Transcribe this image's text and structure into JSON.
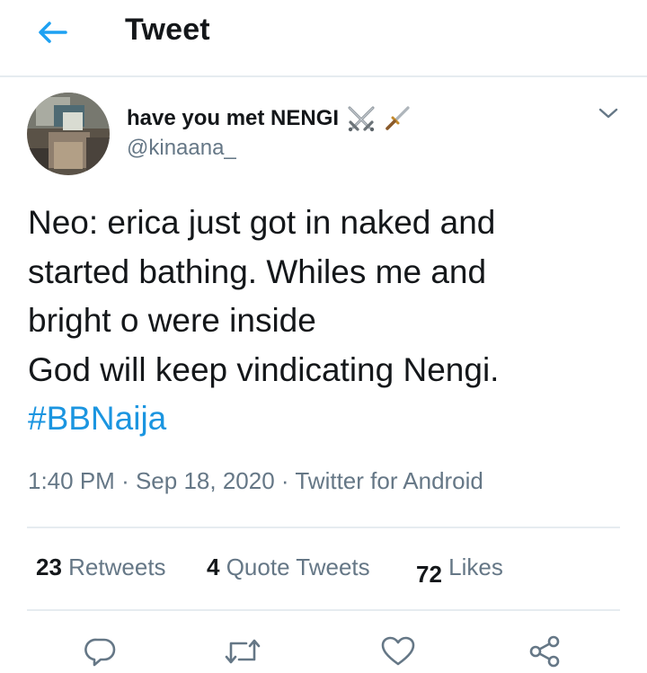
{
  "header": {
    "title": "Tweet",
    "back_icon": "arrow-left-icon",
    "accent": "#1da1f2"
  },
  "author": {
    "display_name": "have you met NENGI",
    "emoji": [
      "crossed-swords-icon",
      "dagger-icon"
    ],
    "handle": "@kinaana_"
  },
  "tweet": {
    "lines": [
      "Neo: erica just got in naked and",
      "started bathing. Whiles me and",
      "bright o were inside",
      "God will keep vindicating Nengi."
    ],
    "hashtag": "#BBNaija",
    "hashtag_color": "#1b95e0",
    "time": "1:40 PM",
    "date": "Sep 18, 2020",
    "source": "Twitter for Android",
    "separator": "·"
  },
  "stats": {
    "retweets": {
      "count": "23",
      "label": "Retweets"
    },
    "quotes": {
      "count": "4",
      "label": "Quote Tweets"
    },
    "likes": {
      "count": "72",
      "label": "Likes"
    }
  },
  "actions": [
    "reply-icon",
    "retweet-icon",
    "like-icon",
    "share-icon"
  ],
  "colors": {
    "text": "#14171a",
    "muted": "#657786",
    "border": "#e6ecf0"
  }
}
